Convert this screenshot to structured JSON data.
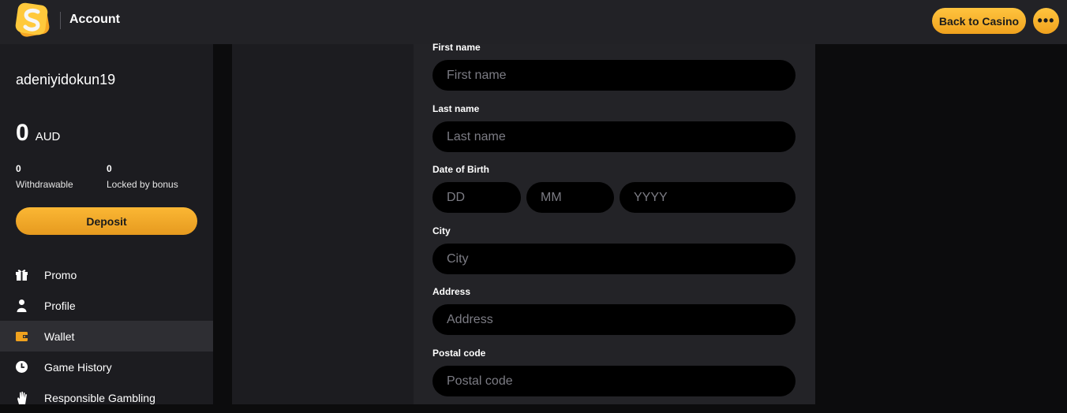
{
  "header": {
    "title": "Account",
    "back_label": "Back to Casino",
    "more_label": "•••"
  },
  "sidebar": {
    "username": "adeniyidokun19",
    "balance": {
      "amount": "0",
      "currency": "AUD"
    },
    "withdrawable": {
      "value": "0",
      "label": "Withdrawable"
    },
    "locked": {
      "value": "0",
      "label": "Locked by bonus"
    },
    "deposit_label": "Deposit",
    "items": [
      {
        "label": "Promo",
        "icon": "gift-icon"
      },
      {
        "label": "Profile",
        "icon": "user-icon"
      },
      {
        "label": "Wallet",
        "icon": "wallet-icon",
        "active": true
      },
      {
        "label": "Game History",
        "icon": "clock-icon"
      },
      {
        "label": "Responsible Gambling",
        "icon": "hand-icon"
      }
    ]
  },
  "form": {
    "first_name": {
      "label": "First name",
      "placeholder": "First name",
      "value": ""
    },
    "last_name": {
      "label": "Last name",
      "placeholder": "Last name",
      "value": ""
    },
    "dob": {
      "label": "Date of Birth",
      "day_placeholder": "DD",
      "month_placeholder": "MM",
      "year_placeholder": "YYYY"
    },
    "city": {
      "label": "City",
      "placeholder": "City",
      "value": ""
    },
    "address": {
      "label": "Address",
      "placeholder": "Address",
      "value": ""
    },
    "postal_code": {
      "label": "Postal code",
      "placeholder": "Postal code",
      "value": ""
    }
  },
  "colors": {
    "accent": "#f5a623",
    "active_icon": "#f0a21e",
    "panel": "#232327",
    "sidebar": "#1c1c20"
  }
}
